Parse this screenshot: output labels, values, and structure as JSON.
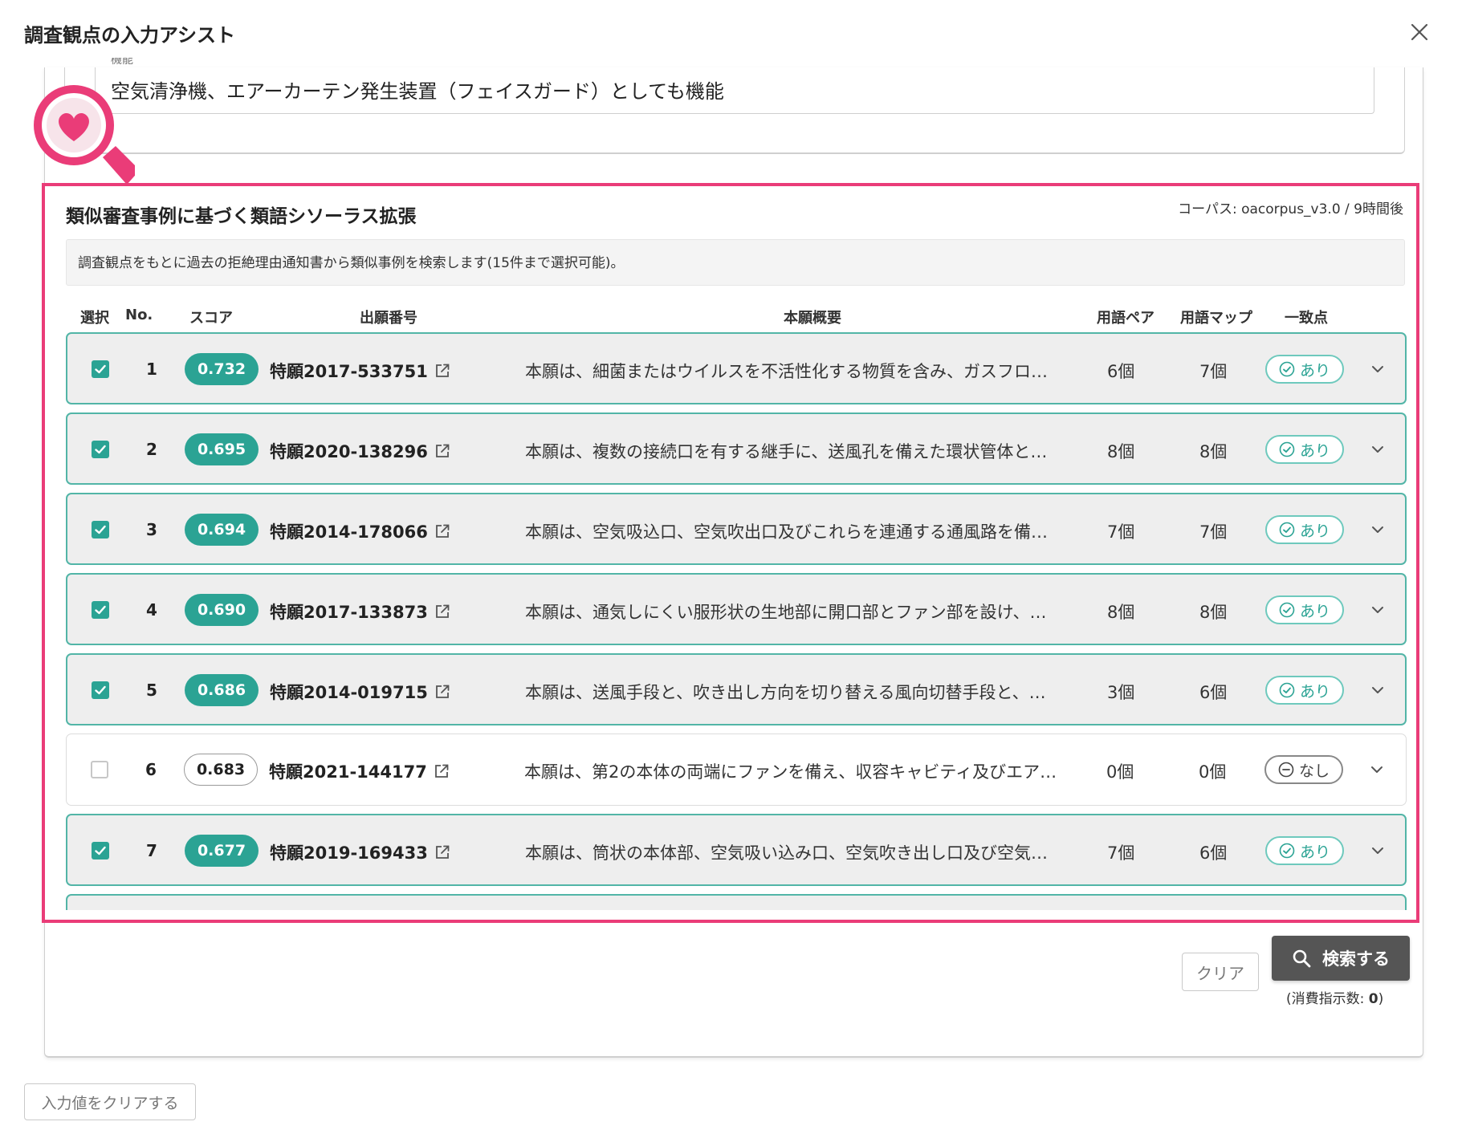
{
  "dialog": {
    "title": "調査観点の入力アシスト"
  },
  "function_field": {
    "label": "機能",
    "value": "空気清浄機、エアーカーテン発生装置（フェイスガード）としても機能"
  },
  "thesaurus": {
    "title": "類似審査事例に基づく類語シソーラス拡張",
    "corpus": "コーパス: oacorpus_v3.0 / 9時間後",
    "description": "調査観点をもとに過去の拒絶理由通知書から類似事例を検索します(15件まで選択可能)。",
    "columns": {
      "select": "選択",
      "no": "No.",
      "score": "スコア",
      "app_number": "出願番号",
      "summary": "本願概要",
      "term_pairs": "用語ペア",
      "term_map": "用語マップ",
      "match": "一致点"
    },
    "rows": [
      {
        "selected": true,
        "no": "1",
        "score": "0.732",
        "app_number": "特願2017-533751",
        "summary": "本願は、細菌またはウイルスを不活性化する物質を含み、ガスフロ…",
        "pairs": "6個",
        "map": "7個",
        "match": "あり"
      },
      {
        "selected": true,
        "no": "2",
        "score": "0.695",
        "app_number": "特願2020-138296",
        "summary": "本願は、複数の接続口を有する継手に、送風孔を備えた環状管体と…",
        "pairs": "8個",
        "map": "8個",
        "match": "あり"
      },
      {
        "selected": true,
        "no": "3",
        "score": "0.694",
        "app_number": "特願2014-178066",
        "summary": "本願は、空気吸込口、空気吹出口及びこれらを連通する通風路を備…",
        "pairs": "7個",
        "map": "7個",
        "match": "あり"
      },
      {
        "selected": true,
        "no": "4",
        "score": "0.690",
        "app_number": "特願2017-133873",
        "summary": "本願は、通気しにくい服形状の生地部に開口部とファン部を設け、…",
        "pairs": "8個",
        "map": "8個",
        "match": "あり"
      },
      {
        "selected": true,
        "no": "5",
        "score": "0.686",
        "app_number": "特願2014-019715",
        "summary": "本願は、送風手段と、吹き出し方向を切り替える風向切替手段と、…",
        "pairs": "3個",
        "map": "6個",
        "match": "あり"
      },
      {
        "selected": false,
        "no": "6",
        "score": "0.683",
        "app_number": "特願2021-144177",
        "summary": "本願は、第2の本体の両端にファンを備え、収容キャビティ及びエア…",
        "pairs": "0個",
        "map": "0個",
        "match": "なし"
      },
      {
        "selected": true,
        "no": "7",
        "score": "0.677",
        "app_number": "特願2019-169433",
        "summary": "本願は、筒状の本体部、空気吸い込み口、空気吹き出し口及び空気…",
        "pairs": "7個",
        "map": "6個",
        "match": "あり"
      }
    ]
  },
  "actions": {
    "clear": "クリア",
    "search": "検索する",
    "consume_label": "(消費指示数: ",
    "consume_value": "0",
    "consume_suffix": ")",
    "reset": "入力値をクリアする"
  },
  "colors": {
    "highlight": "#ea3c78",
    "teal": "#2ba394",
    "search_button": "#555555"
  }
}
